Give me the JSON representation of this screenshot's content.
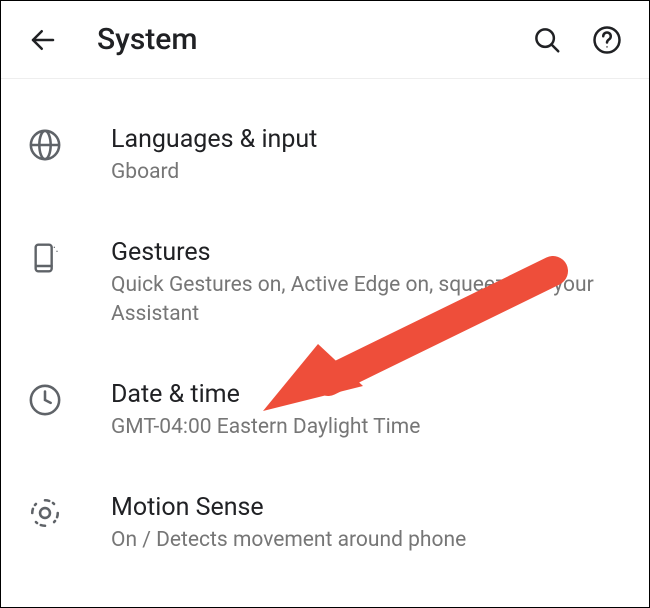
{
  "header": {
    "title": "System"
  },
  "items": [
    {
      "id": "languages",
      "title": "Languages & input",
      "subtitle": "Gboard"
    },
    {
      "id": "gestures",
      "title": "Gestures",
      "subtitle": "Quick Gestures on, Active Edge on, squeeze for your Assistant"
    },
    {
      "id": "datetime",
      "title": "Date & time",
      "subtitle": "GMT-04:00 Eastern Daylight Time"
    },
    {
      "id": "motion",
      "title": "Motion Sense",
      "subtitle": "On / Detects movement around phone"
    }
  ],
  "annotation": {
    "arrow_points_to": "datetime"
  }
}
